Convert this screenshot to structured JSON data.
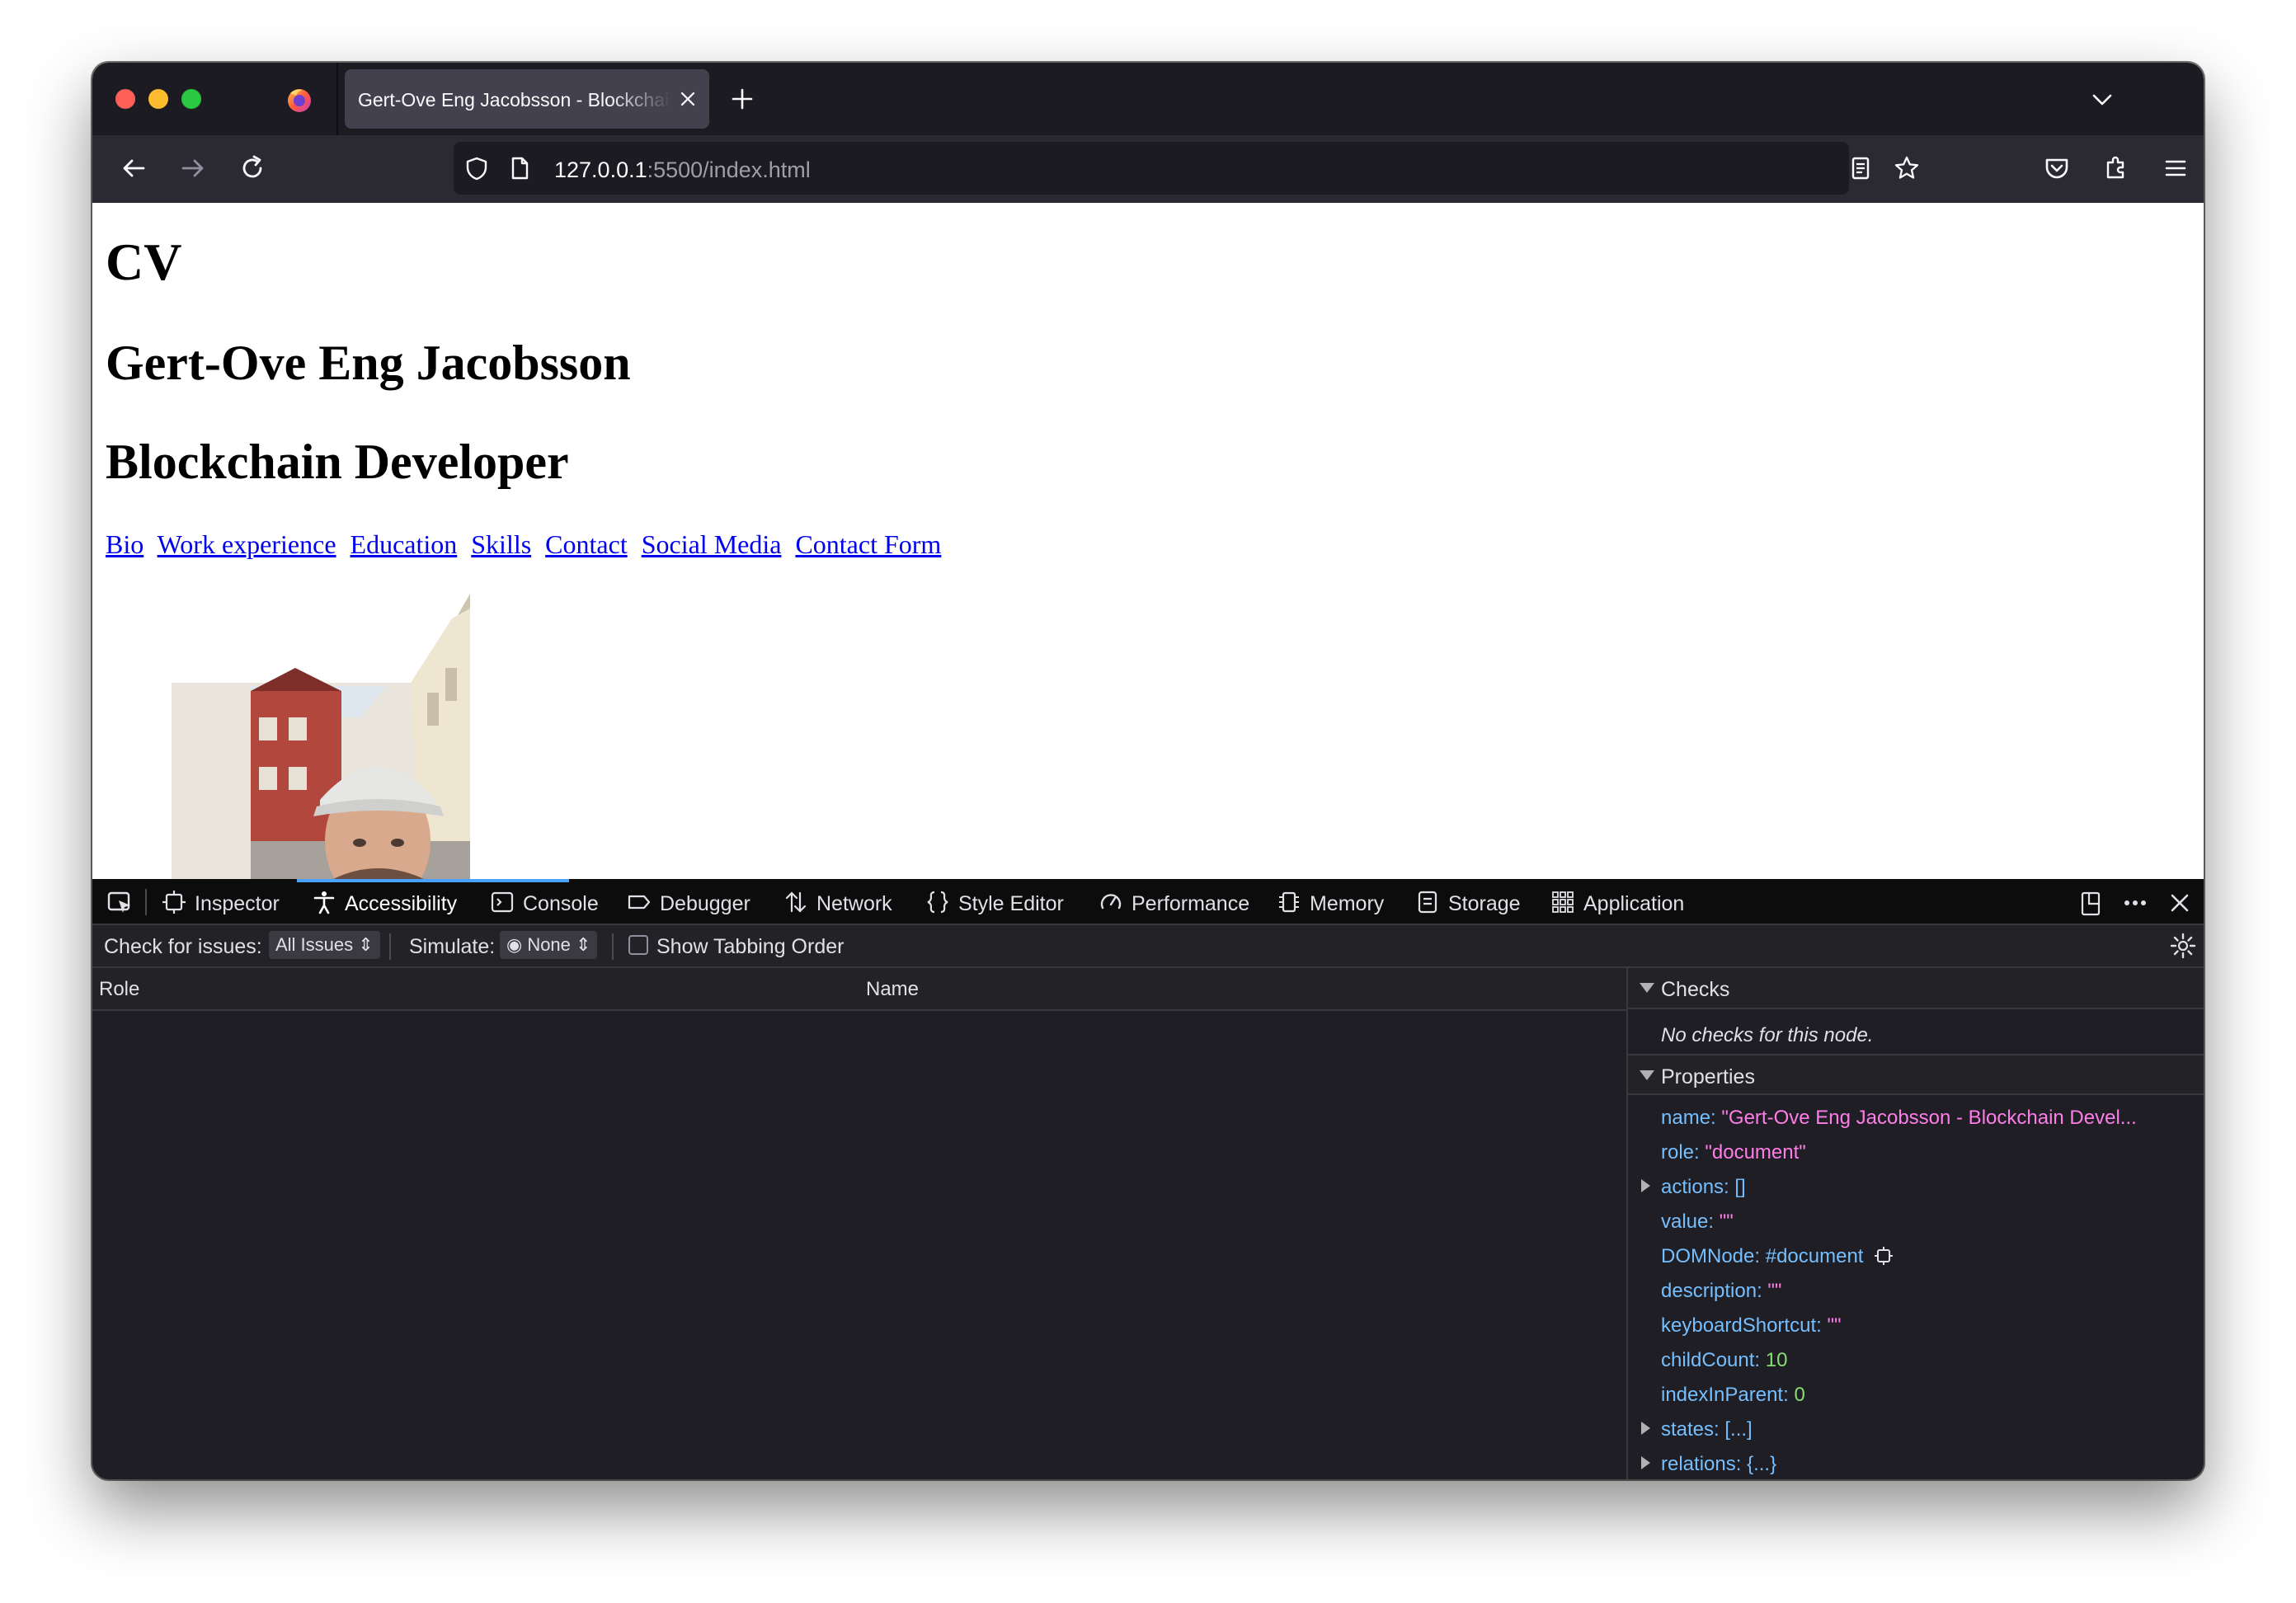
{
  "browser": {
    "tab_title": "Gert-Ove Eng Jacobsson - Blockchain Developer",
    "url_host": "127.0.0.1",
    "url_rest": ":5500/index.html"
  },
  "page": {
    "heading": "CV",
    "name": "Gert-Ove Eng Jacobsson",
    "title": "Blockchain Developer",
    "nav_links": [
      "Bio",
      "Work experience",
      "Education",
      "Skills",
      "Contact",
      "Social Media",
      "Contact Form"
    ]
  },
  "devtools": {
    "tabs": [
      "Inspector",
      "Accessibility",
      "Console",
      "Debugger",
      "Network",
      "Style Editor",
      "Performance",
      "Memory",
      "Storage",
      "Application"
    ],
    "active_tab": "Accessibility",
    "filter": {
      "check_label": "Check for issues:",
      "check_value": "All Issues",
      "simulate_label": "Simulate:",
      "simulate_value": "None",
      "tabbing_label": "Show Tabbing Order"
    },
    "tree_columns": [
      "Role",
      "Name"
    ],
    "checks": {
      "header": "Checks",
      "message": "No checks for this node."
    },
    "properties": {
      "header": "Properties",
      "name_key": "name:",
      "name_value": "\"Gert-Ove Eng Jacobsson - Blockchain Devel...",
      "role_key": "role:",
      "role_value": "\"document\"",
      "actions_key": "actions:",
      "actions_value": "[]",
      "value_key": "value:",
      "value_value": "\"\"",
      "domnode_key": "DOMNode:",
      "domnode_value": "#document",
      "description_key": "description:",
      "description_value": "\"\"",
      "shortcut_key": "keyboardShortcut:",
      "shortcut_value": "\"\"",
      "childcount_key": "childCount:",
      "childcount_value": "10",
      "index_key": "indexInParent:",
      "index_value": "0",
      "states_key": "states:",
      "states_value": "[...]",
      "relations_key": "relations:",
      "relations_value": "{...}"
    }
  },
  "colors": {
    "link": "#0000ee",
    "devtools_accent": "#4aa2ff",
    "prop_key": "#75bfff",
    "prop_string": "#ff7de9",
    "prop_number": "#86de74"
  }
}
